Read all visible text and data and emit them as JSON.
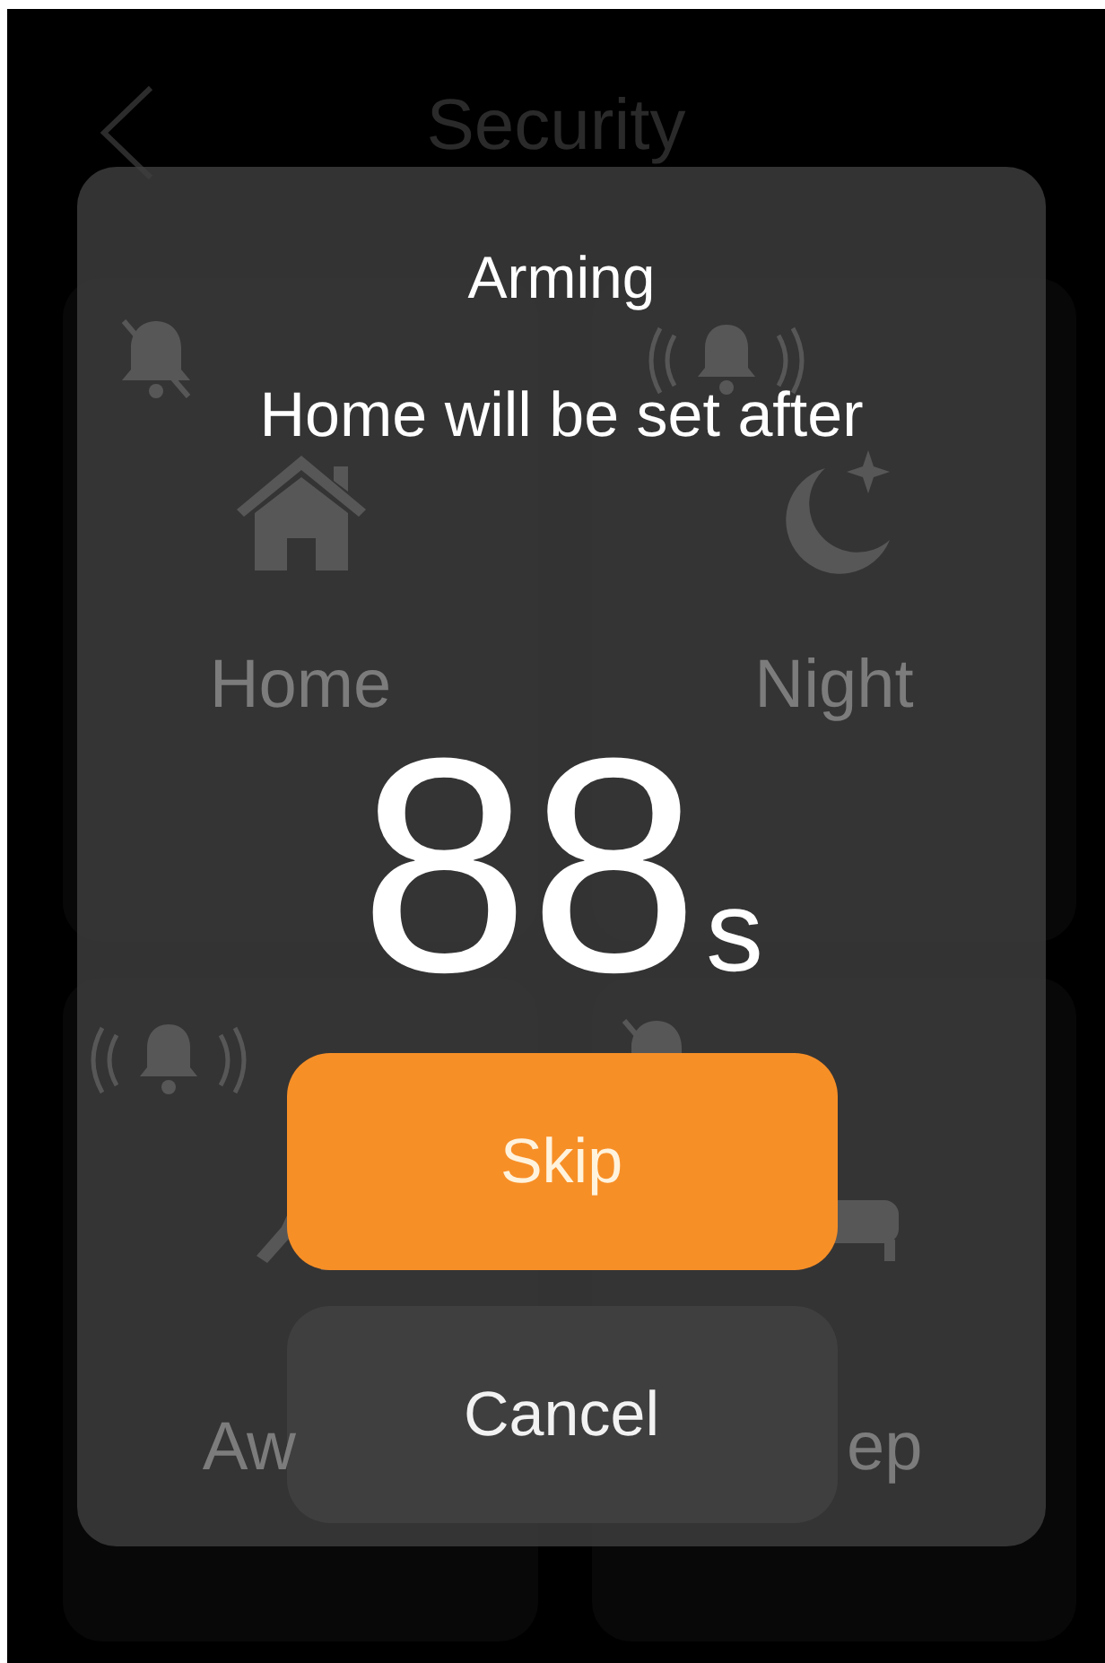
{
  "header": {
    "title": "Security"
  },
  "modes": [
    {
      "kind": "home",
      "label": "Home",
      "muted": true
    },
    {
      "kind": "night",
      "label": "Night",
      "muted": false
    },
    {
      "kind": "away",
      "label": "Aw",
      "muted": false
    },
    {
      "kind": "sleep",
      "label": "ep",
      "muted": true
    }
  ],
  "dialog": {
    "title": "Arming",
    "message": "Home will be set after",
    "count": "88",
    "unit": "s",
    "buttons": [
      {
        "kind": "primary",
        "label": "Skip"
      },
      {
        "kind": "secondary",
        "label": "Cancel"
      }
    ]
  }
}
